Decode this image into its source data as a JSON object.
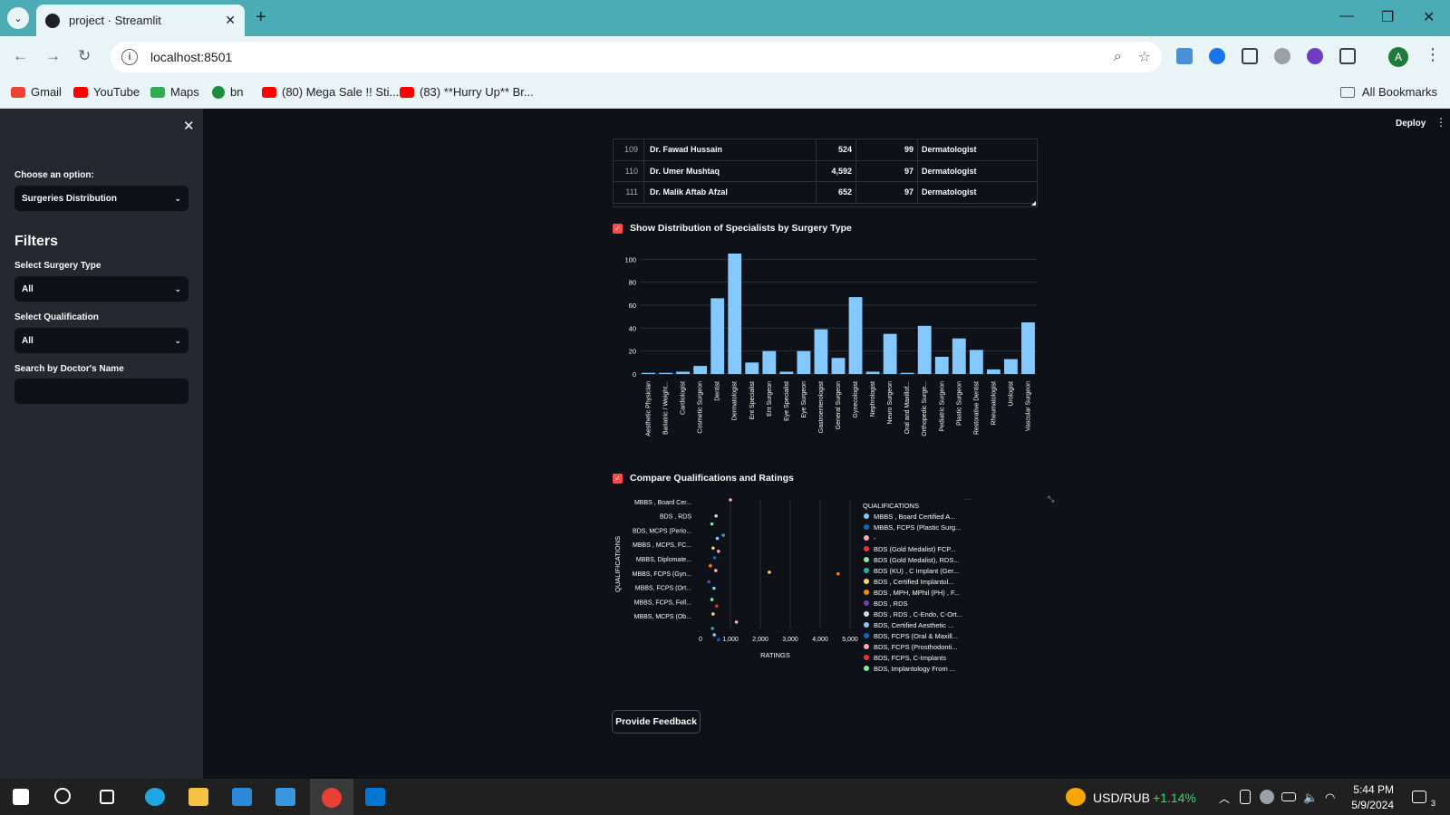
{
  "browser": {
    "tab_title": "project · Streamlit",
    "url": "localhost:8501",
    "bookmarks": [
      {
        "label": "Gmail",
        "color": "#ea4335"
      },
      {
        "label": "YouTube",
        "color": "#ff0000"
      },
      {
        "label": "Maps",
        "color": "#34a853"
      },
      {
        "label": "bn",
        "color": "#1e8e3e"
      },
      {
        "label": "(80) Mega Sale !! Sti...",
        "color": "#ff0000"
      },
      {
        "label": "(83) **Hurry Up** Br...",
        "color": "#ff0000"
      }
    ],
    "all_bookmarks": "All Bookmarks",
    "avatar_letter": "A"
  },
  "sidebar": {
    "choose_label": "Choose an option:",
    "choose_value": "Surgeries Distribution",
    "filters_heading": "Filters",
    "surgery_label": "Select Surgery Type",
    "surgery_value": "All",
    "qualification_label": "Select Qualification",
    "qualification_value": "All",
    "search_label": "Search by Doctor's Name",
    "search_value": ""
  },
  "header": {
    "deploy": "Deploy"
  },
  "table": {
    "rows": [
      {
        "idx": "109",
        "name": "Dr. Fawad Hussain",
        "reviews": "524",
        "rating": "99",
        "specialty": "Dermatologist"
      },
      {
        "idx": "110",
        "name": "Dr. Umer Mushtaq",
        "reviews": "4,592",
        "rating": "97",
        "specialty": "Dermatologist"
      },
      {
        "idx": "111",
        "name": "Dr. Malik Aftab Afzal",
        "reviews": "652",
        "rating": "97",
        "specialty": "Dermatologist"
      }
    ]
  },
  "checkboxes": {
    "distribution": "Show Distribution of Specialists by Surgery Type",
    "compare": "Compare Qualifications and Ratings"
  },
  "feedback_button": "Provide Feedback",
  "chart_data": [
    {
      "type": "bar",
      "title": "",
      "xlabel": "",
      "ylabel": "",
      "ylim": [
        0,
        105
      ],
      "yticks": [
        0,
        20,
        40,
        60,
        80,
        100
      ],
      "grid": true,
      "color": "#83c9ff",
      "categories": [
        "Aesthetic Physician",
        "Bariatric / Weight...",
        "Cardiologist",
        "Cosmetic Surgeon",
        "Dentist",
        "Dermatologist",
        "Ent Specialist",
        "Ent Surgeon",
        "Eye Specialist",
        "Eye Surgeon",
        "Gastroenterologist",
        "General Surgeon",
        "Gynecologist",
        "Nephrologist",
        "Neuro Surgeon",
        "Oral and Maxillof...",
        "Orthopedic Surge...",
        "Pediatric Surgeon",
        "Plastic Surgeon",
        "Restorative Dentist",
        "Rheumatologist",
        "Urologist",
        "Vascular Surgeon"
      ],
      "values": [
        1,
        1,
        2,
        7,
        66,
        105,
        10,
        20,
        2,
        20,
        39,
        14,
        67,
        2,
        35,
        1,
        42,
        15,
        31,
        21,
        4,
        13,
        45
      ]
    },
    {
      "type": "scatter",
      "xlabel": "RATINGS",
      "ylabel": "QUALIFICATIONS",
      "xticks": [
        "0",
        "1,000",
        "2,000",
        "3,000",
        "4,000",
        "5,000"
      ],
      "xlim": [
        0,
        5000
      ],
      "grid": true,
      "y_categories": [
        "MBBS , Board Cer...",
        "BDS , RDS",
        "BDS, MCPS (Perio...",
        "MBBS , MCPS, FC...",
        "MBBS, Diplomate...",
        "MBBS, FCPS (Gyn...",
        "MBBS, FCPS (Ort...",
        "MBBS, FCPS, Fell...",
        "MBBS, MCPS (Ob..."
      ],
      "legend_title": "QUALIFICATIONS",
      "legend": [
        {
          "name": "MBBS , Board Certified A...",
          "color": "#83c9ff"
        },
        {
          "name": "MBBS, FCPS (Plastic Surg...",
          "color": "#0068c9"
        },
        {
          "name": "-",
          "color": "#ffabab"
        },
        {
          "name": "BDS (Gold Medalist) FCP...",
          "color": "#ff2b2b"
        },
        {
          "name": "BDS (Gold Medalist), RDS...",
          "color": "#7defa1"
        },
        {
          "name": "BDS (KU) , C Implant (Ger...",
          "color": "#29b09d"
        },
        {
          "name": "BDS , Certified Implantol...",
          "color": "#ffd16a"
        },
        {
          "name": "BDS , MPH, MPhil (PH) , F...",
          "color": "#ff8700"
        },
        {
          "name": "BDS , RDS",
          "color": "#6d3fc0"
        },
        {
          "name": "BDS , RDS , C-Endo, C-Ort...",
          "color": "#d5dae5"
        },
        {
          "name": "BDS, Certified Aesthetic ...",
          "color": "#83c9ff"
        },
        {
          "name": "BDS, FCPS (Oral & Maxill...",
          "color": "#0068c9"
        },
        {
          "name": "BDS, FCPS (Prosthodonti...",
          "color": "#ffabab"
        },
        {
          "name": "BDS, FCPS, C-Implants",
          "color": "#ff2b2b"
        },
        {
          "name": "BDS, Implantology From ...",
          "color": "#7defa1"
        }
      ],
      "points": [
        {
          "x": 1000,
          "y": 0,
          "color": "#ffabab"
        },
        {
          "x": 520,
          "y": 1,
          "color": "#d5dae5"
        },
        {
          "x": 380,
          "y": 1.5,
          "color": "#7defa1"
        },
        {
          "x": 760,
          "y": 2.2,
          "color": "#29b09d"
        },
        {
          "x": 560,
          "y": 2.4,
          "color": "#83c9ff"
        },
        {
          "x": 420,
          "y": 3.0,
          "color": "#ffd16a"
        },
        {
          "x": 600,
          "y": 3.2,
          "color": "#ffabab"
        },
        {
          "x": 470,
          "y": 3.6,
          "color": "#0068c9"
        },
        {
          "x": 330,
          "y": 4.1,
          "color": "#ff8700"
        },
        {
          "x": 510,
          "y": 4.4,
          "color": "#ffabab"
        },
        {
          "x": 2300,
          "y": 4.5,
          "color": "#ffd16a"
        },
        {
          "x": 4600,
          "y": 4.6,
          "color": "#ff8700"
        },
        {
          "x": 280,
          "y": 5.1,
          "color": "#6d3fc0"
        },
        {
          "x": 450,
          "y": 5.5,
          "color": "#83c9ff"
        },
        {
          "x": 380,
          "y": 6.2,
          "color": "#7defa1"
        },
        {
          "x": 540,
          "y": 6.6,
          "color": "#ff2b2b"
        },
        {
          "x": 420,
          "y": 7.1,
          "color": "#ffd16a"
        },
        {
          "x": 1200,
          "y": 7.6,
          "color": "#ffabab"
        },
        {
          "x": 400,
          "y": 8.0,
          "color": "#29b09d"
        },
        {
          "x": 460,
          "y": 8.4,
          "color": "#83c9ff"
        },
        {
          "x": 600,
          "y": 8.7,
          "color": "#0068c9"
        }
      ]
    }
  ],
  "taskbar": {
    "ticker": "USD/RUB",
    "change": "+1.14%",
    "time": "5:44 PM",
    "date": "5/9/2024",
    "notif": "3"
  }
}
